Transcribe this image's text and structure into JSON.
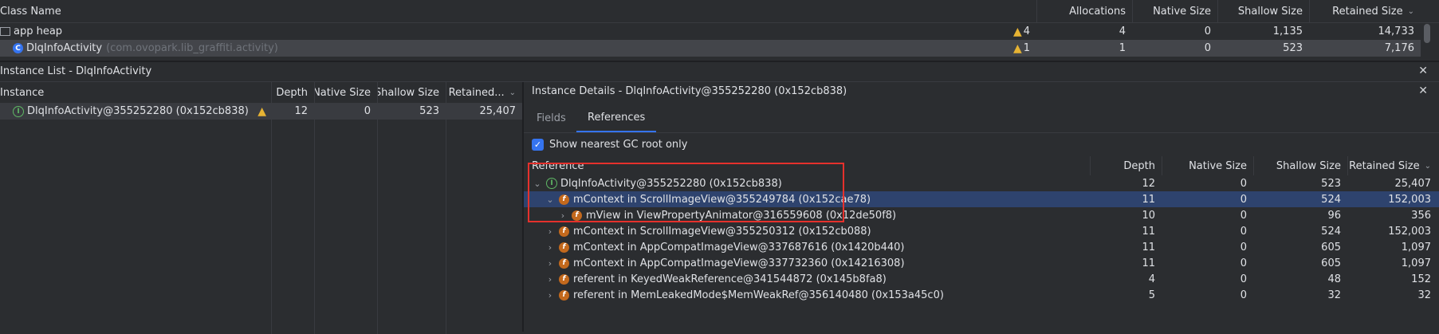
{
  "class_table": {
    "headers": {
      "name": "Class Name",
      "allocations": "Allocations",
      "native": "Native Size",
      "shallow": "Shallow Size",
      "retained": "Retained Size"
    },
    "rows": [
      {
        "name": "app heap",
        "pkg": "",
        "warn": "4",
        "allocations": "4",
        "native": "0",
        "shallow": "1,135",
        "retained": "14,733"
      },
      {
        "name": "DlqInfoActivity",
        "pkg": "(com.ovopark.lib_graffiti.activity)",
        "warn": "1",
        "allocations": "1",
        "native": "0",
        "shallow": "523",
        "retained": "7,176"
      }
    ]
  },
  "instance_list": {
    "title": "Instance List - DlqInfoActivity",
    "headers": {
      "instance": "Instance",
      "depth": "Depth",
      "native": "Native Size",
      "shallow": "Shallow Size",
      "retained": "Retained..."
    },
    "rows": [
      {
        "name": "DlqInfoActivity@355252280 (0x152cb838)",
        "depth": "12",
        "native": "0",
        "shallow": "523",
        "retained": "25,407"
      }
    ]
  },
  "instance_details": {
    "title": "Instance Details - DlqInfoActivity@355252280 (0x152cb838)",
    "tabs": [
      "Fields",
      "References"
    ],
    "active_tab": "References",
    "checkbox_label": "Show nearest GC root only",
    "checkbox_checked": true,
    "headers": {
      "reference": "Reference",
      "depth": "Depth",
      "native": "Native Size",
      "shallow": "Shallow Size",
      "retained": "Retained Size"
    },
    "rows": [
      {
        "name": "DlqInfoActivity@355252280 (0x152cb838)",
        "depth": "12",
        "native": "0",
        "shallow": "523",
        "retained": "25,407"
      },
      {
        "name": "mContext in ScrollImageView@355249784 (0x152cae78)",
        "depth": "11",
        "native": "0",
        "shallow": "524",
        "retained": "152,003"
      },
      {
        "name": "mView in ViewPropertyAnimator@316559608 (0x12de50f8)",
        "depth": "10",
        "native": "0",
        "shallow": "96",
        "retained": "356"
      },
      {
        "name": "mContext in ScrollImageView@355250312 (0x152cb088)",
        "depth": "11",
        "native": "0",
        "shallow": "524",
        "retained": "152,003"
      },
      {
        "name": "mContext in AppCompatImageView@337687616 (0x1420b440)",
        "depth": "11",
        "native": "0",
        "shallow": "605",
        "retained": "1,097"
      },
      {
        "name": "mContext in AppCompatImageView@337732360 (0x14216308)",
        "depth": "11",
        "native": "0",
        "shallow": "605",
        "retained": "1,097"
      },
      {
        "name": "referent in KeyedWeakReference@341544872 (0x145b8fa8)",
        "depth": "4",
        "native": "0",
        "shallow": "48",
        "retained": "152"
      },
      {
        "name": "referent in MemLeakedMode$MemWeakRef@356140480 (0x153a45c0)",
        "depth": "5",
        "native": "0",
        "shallow": "32",
        "retained": "32"
      }
    ]
  },
  "glyphs": {
    "chevron_down": "⌄",
    "chevron_right": "›",
    "sort": "⌄",
    "close": "✕",
    "check": "✓",
    "warn": "▲",
    "expand_open": "⌄",
    "expand_closed": "›"
  },
  "colors": {
    "background": "#2b2d30",
    "selection": "#2e436e",
    "highlight_box": "#e5312c",
    "accent": "#3574f0",
    "tab_underline": "#3574f0"
  }
}
